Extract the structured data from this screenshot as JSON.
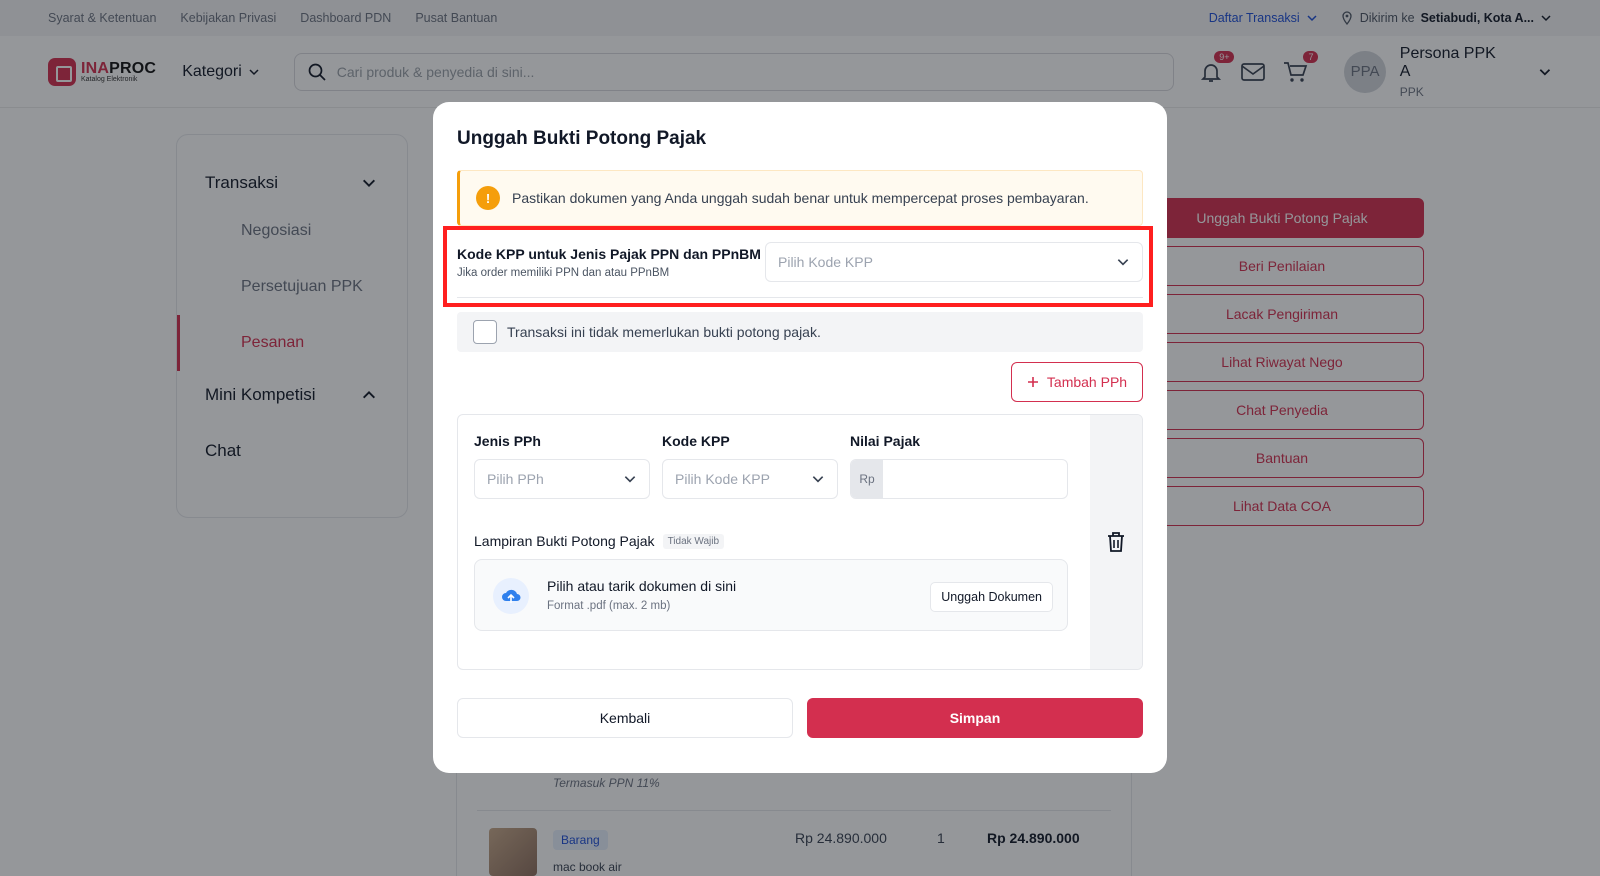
{
  "topbar": {
    "links": [
      "Syarat & Ketentuan",
      "Kebijakan Privasi",
      "Dashboard PDN",
      "Pusat Bantuan"
    ],
    "daftar_transaksi": "Daftar Transaksi",
    "dikirim_ke_label": "Dikirim ke",
    "dikirim_ke_value": "Setiabudi, Kota A..."
  },
  "header": {
    "logo_name_a": "INA",
    "logo_name_b": "PROC",
    "logo_sub": "Katalog Elektronik",
    "kategori": "Kategori",
    "search_placeholder": "Cari produk & penyedia di sini...",
    "notif_badge": "9+",
    "cart_badge": "7",
    "user_initials": "PPA",
    "user_name": "Persona PPK A",
    "user_role": "PPK"
  },
  "sidebar": {
    "group_transaksi": "Transaksi",
    "items": [
      "Negosiasi",
      "Persetujuan PPK",
      "Pesanan"
    ],
    "group_mini": "Mini Kompetisi",
    "chat": "Chat"
  },
  "actions": [
    "Unggah Bukti Potong Pajak",
    "Beri Penilaian",
    "Lacak Pengiriman",
    "Lihat Riwayat Nego",
    "Chat Penyedia",
    "Bantuan",
    "Lihat Data COA"
  ],
  "order": {
    "ppn_note": "Termasuk PPN 11%",
    "tag": "Barang",
    "product_name": "mac book air",
    "price": "Rp 24.890.000",
    "qty": "1",
    "total": "Rp 24.890.000"
  },
  "modal": {
    "title": "Unggah Bukti Potong Pajak",
    "alert": "Pastikan dokumen yang Anda unggah sudah benar untuk mempercepat proses pembayaran.",
    "kpp_label": "Kode KPP untuk Jenis Pajak PPN dan PPnBM",
    "kpp_sub": "Jika order memiliki PPN dan atau PPnBM",
    "kpp_placeholder": "Pilih Kode KPP",
    "no_cut_label": "Transaksi ini tidak memerlukan bukti potong pajak.",
    "add_pph": "Tambah PPh",
    "pph": {
      "jenis_label": "Jenis PPh",
      "jenis_placeholder": "Pilih PPh",
      "kode_label": "Kode KPP",
      "kode_placeholder": "Pilih Kode KPP",
      "nilai_label": "Nilai Pajak",
      "currency": "Rp",
      "lampiran_label": "Lampiran Bukti Potong Pajak",
      "optional_tag": "Tidak Wajib",
      "drop_title": "Pilih atau tarik dokumen di sini",
      "drop_sub": "Format .pdf (max. 2 mb)",
      "upload_button": "Unggah Dokumen"
    },
    "back_button": "Kembali",
    "save_button": "Simpan"
  },
  "colors": {
    "brand": "#d32f4f",
    "warning": "#f59e0b",
    "highlight": "#ff1f1f",
    "link": "#1d4ed8"
  },
  "icons": [
    "search-icon",
    "bell-icon",
    "mail-icon",
    "cart-icon",
    "location-icon",
    "chevron-down-icon",
    "warning-icon",
    "plus-icon",
    "trash-icon",
    "cloud-upload-icon"
  ]
}
